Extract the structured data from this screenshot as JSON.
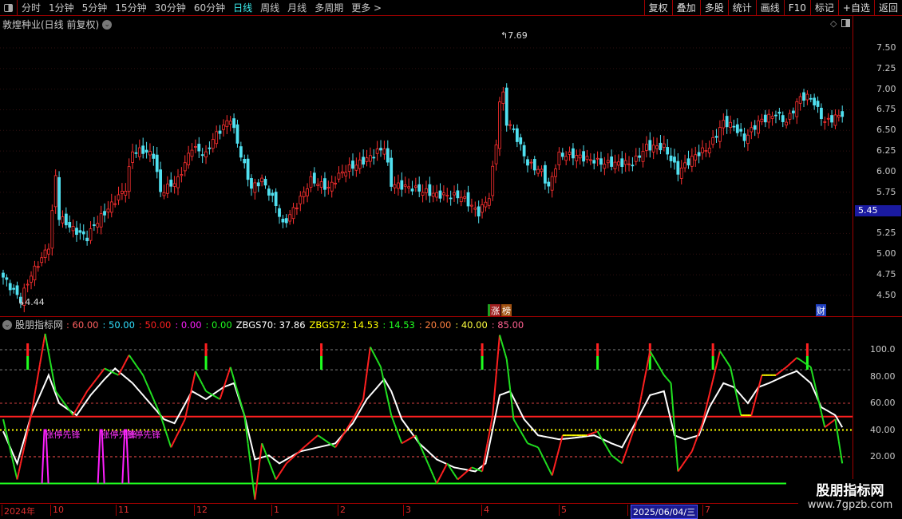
{
  "toolbar": {
    "periods": [
      "分时",
      "1分钟",
      "5分钟",
      "15分钟",
      "30分钟",
      "60分钟",
      "日线",
      "周线",
      "月线",
      "多周期",
      "更多 >"
    ],
    "active": "日线",
    "buttons": [
      "复权",
      "叠加",
      "多股",
      "统计",
      "画线",
      "F10",
      "标记",
      "+自选",
      "返回"
    ]
  },
  "stock": {
    "title": "敦煌种业(日线 前复权)",
    "current_price": "5.45",
    "high_label": "7.69",
    "low_label": "4.44"
  },
  "price_axis": [
    "7.50",
    "7.25",
    "7.00",
    "6.75",
    "6.50",
    "6.25",
    "6.00",
    "5.75",
    "5.25",
    "5.00",
    "4.75",
    "4.50"
  ],
  "tags": {
    "zt": "涨",
    "bang": "榜",
    "cai": "财"
  },
  "indicator": {
    "name": "股朋指标网",
    "values": [
      {
        "t": ": 60.00",
        "c": "#ff6060"
      },
      {
        "t": ": 50.00",
        "c": "#30e0ff"
      },
      {
        "t": ": 50.00",
        "c": "#ff2020"
      },
      {
        "t": ": 0.00",
        "c": "#ff20ff"
      },
      {
        "t": ": 0.00",
        "c": "#20ff20"
      },
      {
        "t": "ZBGS70: 37.86",
        "c": "#ffffff"
      },
      {
        "t": "ZBGS72: 14.53",
        "c": "#ffff00"
      },
      {
        "t": ": 14.53",
        "c": "#20ff20"
      },
      {
        "t": ": 20.00",
        "c": "#ff8040"
      },
      {
        "t": ": 40.00",
        "c": "#ffff40"
      },
      {
        "t": ": 85.00",
        "c": "#ff6090"
      }
    ],
    "axis": [
      "100.0",
      "80.00",
      "60.00",
      "40.00",
      "20.00"
    ],
    "signal_label": "涨停先锋"
  },
  "time_axis": [
    "2024年",
    "10",
    "11",
    "12",
    "1",
    "2",
    "3",
    "4",
    "5",
    "6",
    "7"
  ],
  "cursor_date": "2025/06/04/三",
  "watermark": {
    "name": "股朋指标网",
    "url": "www.7gpzb.com"
  },
  "chart_data": {
    "type": "candlestick",
    "price_keypoints": [
      [
        0,
        4.72
      ],
      [
        3,
        4.55
      ],
      [
        5,
        4.45
      ],
      [
        8,
        4.75
      ],
      [
        11,
        4.95
      ],
      [
        13,
        5.1
      ],
      [
        14,
        5.5
      ],
      [
        15,
        5.95
      ],
      [
        16,
        5.45
      ],
      [
        20,
        5.3
      ],
      [
        24,
        5.2
      ],
      [
        26,
        5.35
      ],
      [
        30,
        5.55
      ],
      [
        35,
        5.8
      ],
      [
        37,
        6.25
      ],
      [
        40,
        6.25
      ],
      [
        43,
        6.2
      ],
      [
        45,
        5.75
      ],
      [
        50,
        5.9
      ],
      [
        54,
        6.3
      ],
      [
        58,
        6.2
      ],
      [
        60,
        6.4
      ],
      [
        65,
        6.65
      ],
      [
        68,
        6.2
      ],
      [
        71,
        5.8
      ],
      [
        74,
        5.9
      ],
      [
        78,
        5.6
      ],
      [
        80,
        5.35
      ],
      [
        84,
        5.6
      ],
      [
        88,
        5.9
      ],
      [
        93,
        5.8
      ],
      [
        97,
        6.0
      ],
      [
        104,
        6.15
      ],
      [
        109,
        6.3
      ],
      [
        111,
        5.85
      ],
      [
        117,
        5.8
      ],
      [
        124,
        5.72
      ],
      [
        131,
        5.7
      ],
      [
        136,
        5.5
      ],
      [
        139,
        5.7
      ],
      [
        141,
        6.35
      ],
      [
        142.5,
        7.1
      ],
      [
        144,
        6.6
      ],
      [
        146,
        6.5
      ],
      [
        150,
        6.1
      ],
      [
        154,
        6.0
      ],
      [
        156,
        5.8
      ],
      [
        159,
        6.2
      ],
      [
        163,
        6.2
      ],
      [
        172,
        6.1
      ],
      [
        180,
        6.1
      ],
      [
        184,
        6.3
      ],
      [
        189,
        6.3
      ],
      [
        193,
        6.0
      ],
      [
        198,
        6.2
      ],
      [
        202,
        6.3
      ],
      [
        206,
        6.6
      ],
      [
        209,
        6.55
      ],
      [
        212,
        6.4
      ],
      [
        216,
        6.6
      ],
      [
        221,
        6.7
      ],
      [
        224,
        6.6
      ],
      [
        228,
        6.9
      ],
      [
        231,
        6.9
      ],
      [
        235,
        6.6
      ],
      [
        240,
        6.7
      ]
    ],
    "osc_keypoints": [
      [
        0,
        48
      ],
      [
        4,
        3
      ],
      [
        8,
        51
      ],
      [
        12,
        112
      ],
      [
        15,
        69
      ],
      [
        20,
        51
      ],
      [
        24,
        69
      ],
      [
        29,
        86
      ],
      [
        33,
        81
      ],
      [
        36,
        96
      ],
      [
        40,
        81
      ],
      [
        45,
        51
      ],
      [
        48,
        27
      ],
      [
        52,
        48
      ],
      [
        55,
        84
      ],
      [
        58,
        69
      ],
      [
        62,
        63
      ],
      [
        65,
        87
      ],
      [
        69,
        51
      ],
      [
        72,
        -12
      ],
      [
        74,
        30
      ],
      [
        78,
        3
      ],
      [
        81,
        15
      ],
      [
        86,
        27
      ],
      [
        90,
        36
      ],
      [
        95,
        27
      ],
      [
        100,
        48
      ],
      [
        103,
        63
      ],
      [
        105,
        102
      ],
      [
        108,
        87
      ],
      [
        111,
        51
      ],
      [
        114,
        30
      ],
      [
        118,
        36
      ],
      [
        124,
        0
      ],
      [
        127,
        15
      ],
      [
        130,
        3
      ],
      [
        134,
        12
      ],
      [
        137,
        9
      ],
      [
        140,
        51
      ],
      [
        142,
        111
      ],
      [
        144,
        93
      ],
      [
        146,
        48
      ],
      [
        150,
        30
      ],
      [
        153,
        27
      ],
      [
        157,
        6
      ],
      [
        160,
        36
      ],
      [
        163,
        36
      ],
      [
        167,
        36
      ],
      [
        170,
        39
      ],
      [
        174,
        21
      ],
      [
        177,
        15
      ],
      [
        181,
        45
      ],
      [
        185,
        99
      ],
      [
        189,
        81
      ],
      [
        191,
        75
      ],
      [
        193,
        9
      ],
      [
        197,
        24
      ],
      [
        200,
        45
      ],
      [
        205,
        99
      ],
      [
        208,
        87
      ],
      [
        211,
        51
      ],
      [
        214,
        51
      ],
      [
        217,
        81
      ],
      [
        221,
        81
      ],
      [
        224,
        87
      ],
      [
        227,
        94
      ],
      [
        231,
        87
      ],
      [
        235,
        42
      ],
      [
        238,
        48
      ],
      [
        240,
        15
      ]
    ],
    "signal_keypoints": [
      [
        0,
        39
      ],
      [
        4,
        15
      ],
      [
        8,
        51
      ],
      [
        13,
        81
      ],
      [
        16,
        60
      ],
      [
        21,
        51
      ],
      [
        25,
        66
      ],
      [
        29,
        78
      ],
      [
        32,
        86
      ],
      [
        37,
        75
      ],
      [
        41,
        63
      ],
      [
        46,
        48
      ],
      [
        49,
        45
      ],
      [
        54,
        69
      ],
      [
        58,
        63
      ],
      [
        63,
        72
      ],
      [
        66,
        75
      ],
      [
        69,
        51
      ],
      [
        72,
        18
      ],
      [
        76,
        21
      ],
      [
        79,
        15
      ],
      [
        85,
        24
      ],
      [
        90,
        27
      ],
      [
        95,
        30
      ],
      [
        100,
        45
      ],
      [
        104,
        63
      ],
      [
        109,
        78
      ],
      [
        111,
        69
      ],
      [
        114,
        48
      ],
      [
        119,
        30
      ],
      [
        124,
        18
      ],
      [
        129,
        12
      ],
      [
        135,
        9
      ],
      [
        138,
        15
      ],
      [
        142,
        66
      ],
      [
        145,
        69
      ],
      [
        149,
        48
      ],
      [
        153,
        36
      ],
      [
        159,
        33
      ],
      [
        163,
        34
      ],
      [
        169,
        36
      ],
      [
        174,
        30
      ],
      [
        177,
        27
      ],
      [
        182,
        51
      ],
      [
        185,
        66
      ],
      [
        189,
        69
      ],
      [
        192,
        36
      ],
      [
        195,
        33
      ],
      [
        199,
        36
      ],
      [
        202,
        57
      ],
      [
        206,
        75
      ],
      [
        209,
        72
      ],
      [
        213,
        60
      ],
      [
        216,
        72
      ],
      [
        219,
        75
      ],
      [
        224,
        81
      ],
      [
        227,
        84
      ],
      [
        231,
        75
      ],
      [
        234,
        57
      ],
      [
        238,
        51
      ],
      [
        240,
        42
      ]
    ],
    "signal_bars_days": [
      7,
      58,
      91,
      137,
      170,
      185,
      203,
      230
    ],
    "limitup_days": [
      12,
      28,
      35
    ],
    "price_range": [
      4.4,
      7.75
    ],
    "osc_range": [
      -12,
      115
    ],
    "ref_lines": [
      {
        "v": 100,
        "c": "#808080"
      },
      {
        "v": 85,
        "c": "#808080"
      },
      {
        "v": 60,
        "c": "#d04040"
      },
      {
        "v": 50,
        "c": "#ff2020"
      },
      {
        "v": 40,
        "c": "#ffff00"
      },
      {
        "v": 20,
        "c": "#ff5050"
      },
      {
        "v": 0,
        "c": "#20ff20"
      }
    ]
  }
}
